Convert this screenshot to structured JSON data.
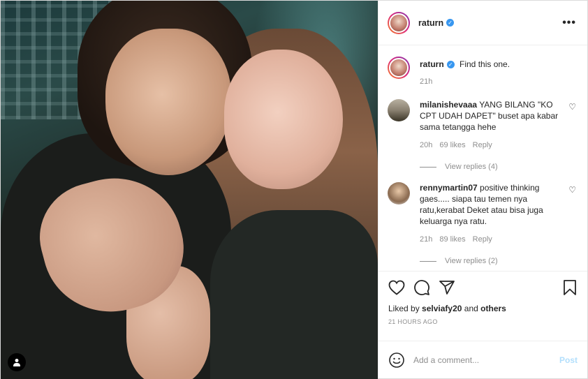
{
  "post": {
    "author": "raturn",
    "verified": true,
    "more_icon": "more-horizontal-icon"
  },
  "caption": {
    "author": "raturn",
    "text": "Find this one.",
    "time": "21h"
  },
  "comments": [
    {
      "author": "milanishevaaa",
      "text": "YANG BILANG \"KO CPT UDAH DAPET\" buset apa kabar sama tetangga hehe",
      "time": "20h",
      "likes": "69 likes",
      "reply": "Reply",
      "view_replies": "View replies (4)"
    },
    {
      "author": "rennymartin07",
      "text": "positive thinking gaes..... siapa tau temen nya ratu,kerabat Deket atau bisa juga keluarga nya ratu.",
      "time": "21h",
      "likes": "89 likes",
      "reply": "Reply",
      "view_replies": "View replies (2)"
    }
  ],
  "actions": {
    "liked_prefix": "Liked by",
    "liked_user": "selviafy20",
    "liked_and": "and",
    "liked_others": "others",
    "timestamp": "21 HOURS AGO"
  },
  "add_comment": {
    "placeholder": "Add a comment...",
    "post_label": "Post"
  },
  "colors": {
    "verified": "#3897f0",
    "post_disabled": "#b2dffc",
    "muted": "#8e8e8e"
  }
}
